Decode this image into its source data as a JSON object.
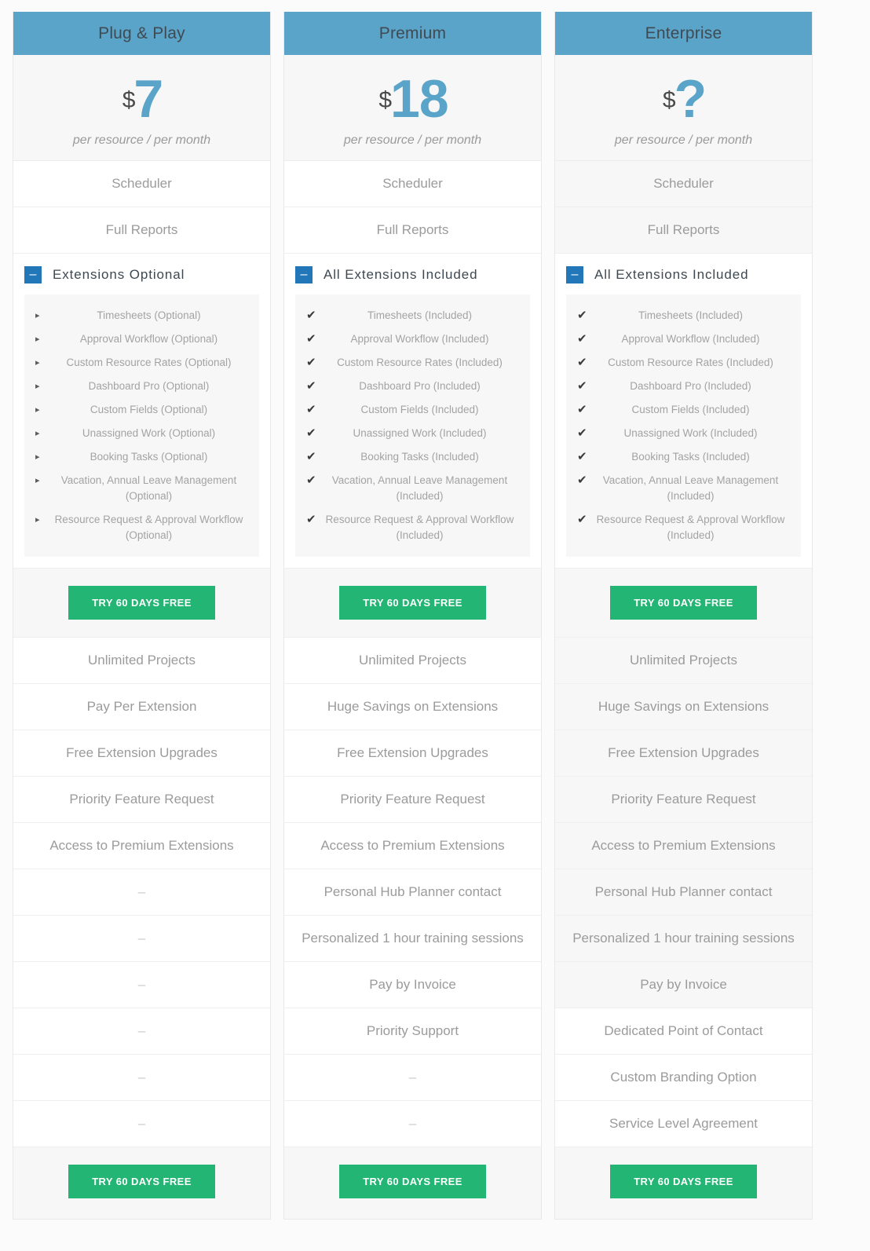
{
  "page": {
    "accent_blue": "#5ba4c9",
    "toggle_blue": "#2277b8",
    "cta_green": "#22b573",
    "row_shade": "#f7f7f7"
  },
  "shared": {
    "price_sub": "per resource / per month",
    "currency": "$",
    "cta_label": "TRY 60 DAYS FREE",
    "toggle_glyph": "–",
    "bullet_glyph": "▸",
    "check_glyph": "✔",
    "dash": "–"
  },
  "plans": [
    {
      "name": "Plug & Play",
      "price": "7",
      "currency": "$",
      "price_sub": "per resource / per month",
      "top_features": [
        "Scheduler",
        "Full Reports"
      ],
      "ext_title": "Extensions Optional",
      "ext_marker": "bullet",
      "extensions": [
        "Timesheets (Optional)",
        "Approval Workflow (Optional)",
        "Custom Resource Rates (Optional)",
        "Dashboard Pro (Optional)",
        "Custom Fields (Optional)",
        "Unassigned Work (Optional)",
        "Booking Tasks (Optional)",
        "Vacation, Annual Leave Management (Optional)",
        "Resource Request & Approval Workflow (Optional)"
      ],
      "bottom_features": [
        "Unlimited Projects",
        "Pay Per Extension",
        "Free Extension Upgrades",
        "Priority Feature Request",
        "Access to Premium Extensions",
        "–",
        "–",
        "–",
        "–",
        "–",
        "–"
      ],
      "shaded_rows": false,
      "cta_label": "TRY 60 DAYS FREE"
    },
    {
      "name": "Premium",
      "price": "18",
      "currency": "$",
      "price_sub": "per resource / per month",
      "top_features": [
        "Scheduler",
        "Full Reports"
      ],
      "ext_title": "All Extensions Included",
      "ext_marker": "check",
      "extensions": [
        "Timesheets (Included)",
        "Approval Workflow (Included)",
        "Custom Resource Rates (Included)",
        "Dashboard Pro (Included)",
        "Custom Fields (Included)",
        "Unassigned Work (Included)",
        "Booking Tasks (Included)",
        "Vacation, Annual Leave Management (Included)",
        "Resource Request & Approval Workflow (Included)"
      ],
      "bottom_features": [
        "Unlimited Projects",
        "Huge Savings on Extensions",
        "Free Extension Upgrades",
        "Priority Feature Request",
        "Access to Premium Extensions",
        "Personal Hub Planner contact",
        "Personalized 1 hour training sessions",
        "Pay by Invoice",
        "Priority Support",
        "–",
        "–"
      ],
      "shaded_rows": false,
      "cta_label": "TRY 60 DAYS FREE"
    },
    {
      "name": "Enterprise",
      "price": "?",
      "currency": "$",
      "price_sub": "per resource / per month",
      "top_features": [
        "Scheduler",
        "Full Reports"
      ],
      "ext_title": "All Extensions Included",
      "ext_marker": "check",
      "extensions": [
        "Timesheets (Included)",
        "Approval Workflow (Included)",
        "Custom Resource Rates (Included)",
        "Dashboard Pro (Included)",
        "Custom Fields (Included)",
        "Unassigned Work (Included)",
        "Booking Tasks (Included)",
        "Vacation, Annual Leave Management (Included)",
        "Resource Request & Approval Workflow (Included)"
      ],
      "bottom_features": [
        "Unlimited Projects",
        "Huge Savings on Extensions",
        "Free Extension Upgrades",
        "Priority Feature Request",
        "Access to Premium Extensions",
        "Personal Hub Planner contact",
        "Personalized 1 hour training sessions",
        "Pay by Invoice",
        "Dedicated Point of Contact",
        "Custom Branding Option",
        "Service Level Agreement"
      ],
      "shaded_rows": true,
      "white_from_index": 8,
      "cta_label": "TRY 60 DAYS FREE"
    }
  ]
}
